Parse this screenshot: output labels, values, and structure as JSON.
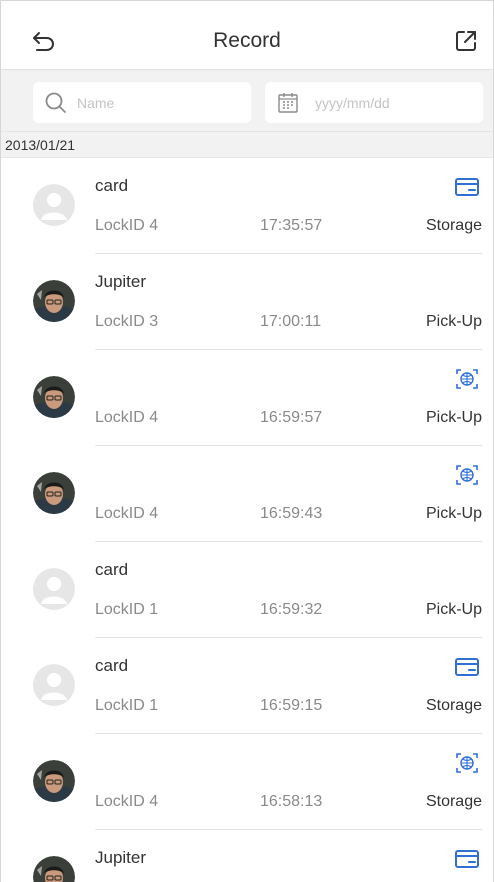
{
  "header": {
    "title": "Record",
    "back_icon": "back-arrow-icon",
    "export_icon": "export-icon"
  },
  "filter": {
    "name_placeholder": "Name",
    "date_placeholder": "yyyy/mm/dd",
    "search_icon": "search-icon",
    "calendar_icon": "calendar-icon"
  },
  "colors": {
    "accent": "#2f6fd6",
    "filter_bg": "#f2f2f2",
    "secondary_text": "#8a8a8a"
  },
  "group": {
    "date": "2013/01/21"
  },
  "records": [
    {
      "name": "card",
      "lock": "LockID 4",
      "time": "17:35:57",
      "type": "Storage",
      "method": "card-icon",
      "avatar": "default"
    },
    {
      "name": "Jupiter",
      "lock": "LockID 3",
      "time": "17:00:11",
      "type": "Pick-Up",
      "method": "",
      "avatar": "photo"
    },
    {
      "name": "",
      "lock": "LockID 4",
      "time": "16:59:57",
      "type": "Pick-Up",
      "method": "face-scan-icon",
      "avatar": "photo"
    },
    {
      "name": "",
      "lock": "LockID 4",
      "time": "16:59:43",
      "type": "Pick-Up",
      "method": "face-scan-icon",
      "avatar": "photo"
    },
    {
      "name": "card",
      "lock": "LockID 1",
      "time": "16:59:32",
      "type": "Pick-Up",
      "method": "",
      "avatar": "default"
    },
    {
      "name": "card",
      "lock": "LockID 1",
      "time": "16:59:15",
      "type": "Storage",
      "method": "card-icon",
      "avatar": "default"
    },
    {
      "name": "",
      "lock": "LockID 4",
      "time": "16:58:13",
      "type": "Storage",
      "method": "face-scan-icon",
      "avatar": "photo"
    },
    {
      "name": "Jupiter",
      "lock": "",
      "time": "",
      "type": "",
      "method": "card-icon",
      "avatar": "photo"
    }
  ]
}
